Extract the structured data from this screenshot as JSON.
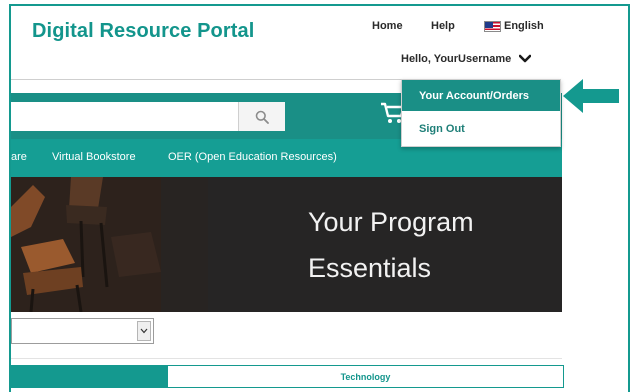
{
  "header": {
    "title": "Digital Resource Portal",
    "nav": {
      "home": "Home",
      "help": "Help",
      "language": "English"
    },
    "greeting": "Hello, YourUsername"
  },
  "search": {
    "value": "",
    "placeholder": ""
  },
  "category_nav": {
    "items": [
      "are",
      "Virtual Bookstore",
      "OER (Open Education Resources)"
    ]
  },
  "banner": {
    "line1": "Your Program",
    "line2": "Essentials"
  },
  "account_menu": {
    "items": [
      "Your Account/Orders",
      "Sign Out"
    ],
    "selected_index": 0
  },
  "filters": {
    "select_value": ""
  },
  "tabs": {
    "labels": [
      "",
      "Technology"
    ],
    "active_index": 0
  },
  "theme": {
    "accent": "#14998f",
    "accent_dark": "#1a8f86",
    "banner_bg": "#262525"
  },
  "icons": {
    "search": "search-icon",
    "cart": "cart-icon",
    "chevron": "chevron-down-icon",
    "flag": "us-flag-icon",
    "callout": "arrow-left-icon"
  }
}
